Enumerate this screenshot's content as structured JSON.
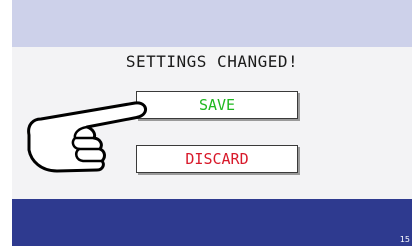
{
  "dialog": {
    "title": "SETTINGS CHANGED!"
  },
  "buttons": {
    "save": {
      "label": "SAVE",
      "color": "#1fb81f"
    },
    "discard": {
      "label": "DISCARD",
      "color": "#d8192a"
    }
  },
  "footer": {
    "page_number": "15"
  },
  "colors": {
    "top_bar": "#cdd1ea",
    "content_bg": "#f3f3f5",
    "bottom_bar": "#2e3a8f"
  },
  "icons": {
    "pointer": "pointing-hand-icon"
  }
}
